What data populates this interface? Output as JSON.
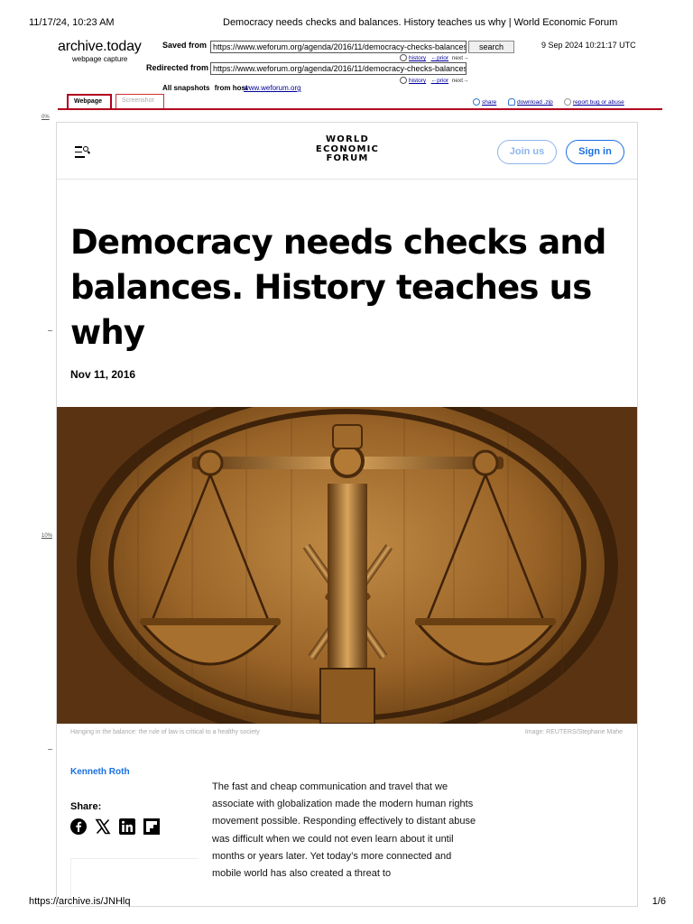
{
  "print": {
    "datetime": "11/17/24, 10:23 AM",
    "doc_title": "Democracy needs checks and balances. History teaches us why | World Economic Forum",
    "footer_url": "https://archive.is/JNHlq",
    "page_count": "1/6"
  },
  "archive": {
    "logo": "archive.today",
    "logo_sub": "webpage capture",
    "saved_from_label": "Saved from",
    "saved_from_url": "https://www.weforum.org/agenda/2016/11/democracy-checks-balances/",
    "search_label": "search",
    "timestamp": "9 Sep 2024 10:21:17 UTC",
    "redirected_label": "Redirected from",
    "redirected_url": "https://www.weforum.org/agenda/2016/11/democracy-checks-balances",
    "history": "history",
    "prior": "←prior",
    "next": "next→",
    "all_snapshots_label": "All snapshots",
    "from_host_label": "from host",
    "host": "www.weforum.org",
    "tab_webpage": "Webpage",
    "tab_screenshot": "Screenshot",
    "share": "share",
    "download": "download .zip",
    "report": "report bug or abuse",
    "pct_0": "0%",
    "pct_10": "10%"
  },
  "site": {
    "logo_lines": [
      "WORLD",
      "ECONOMIC",
      "FORUM"
    ],
    "join_label": "Join us",
    "signin_label": "Sign in",
    "accent": "#1a6fe0"
  },
  "article": {
    "title": "Democracy needs checks and balances. History teaches us why",
    "date": "Nov 11, 2016",
    "caption": "Hanging in the balance: the rule of law is critical to a healthy society",
    "credit": "Image: REUTERS/Stephane Mahe",
    "author": "Kenneth Roth",
    "share_label": "Share:",
    "share_icons": [
      "facebook-icon",
      "x-icon",
      "linkedin-icon",
      "flipboard-icon"
    ],
    "body": "The fast and cheap communication and travel that we associate with globalization made the modern human rights movement possible. Responding effectively to distant abuse was difficult when we could not even learn about it until months or years later. Yet today’s more connected and mobile world has also created a threat to"
  }
}
